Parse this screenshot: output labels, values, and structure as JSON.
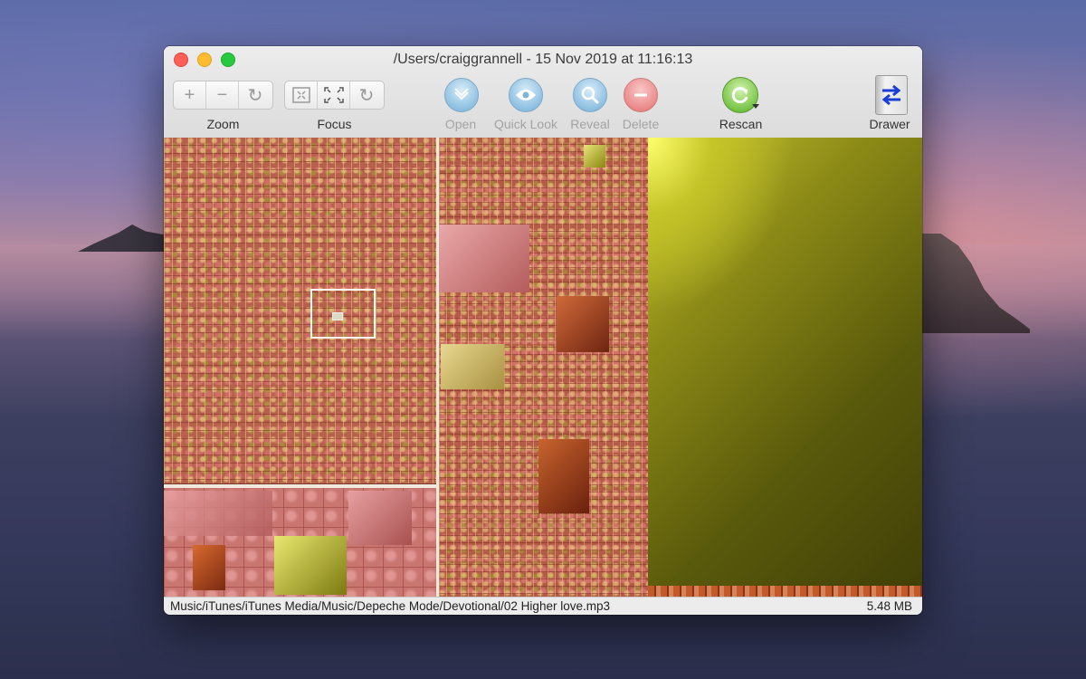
{
  "window": {
    "title": "/Users/craiggrannell - 15 Nov 2019 at 11:16:13"
  },
  "toolbar": {
    "zoom": {
      "label": "Zoom",
      "buttons": [
        {
          "name": "zoom-in",
          "glyph": "+"
        },
        {
          "name": "zoom-out",
          "glyph": "−"
        },
        {
          "name": "zoom-reset",
          "glyph": "↻"
        }
      ]
    },
    "focus": {
      "label": "Focus",
      "buttons": [
        {
          "name": "focus-in",
          "icon": "focus-in-icon"
        },
        {
          "name": "focus-out",
          "icon": "focus-out-icon"
        },
        {
          "name": "focus-reset",
          "glyph": "↻"
        }
      ]
    },
    "open_label": "Open",
    "quick_look_label": "Quick Look",
    "reveal_label": "Reveal",
    "delete_label": "Delete",
    "rescan_label": "Rescan",
    "drawer_label": "Drawer"
  },
  "status": {
    "path": "Music/iTunes/iTunes Media/Music/Depeche Mode/Devotional/02 Higher love.mp3",
    "size": "5.48 MB"
  },
  "colors": {
    "close": "#fe5f57",
    "minimize": "#febc2e",
    "maximize": "#28c840",
    "treemap_yellow": "#c9c733",
    "treemap_red": "#b8604e"
  }
}
